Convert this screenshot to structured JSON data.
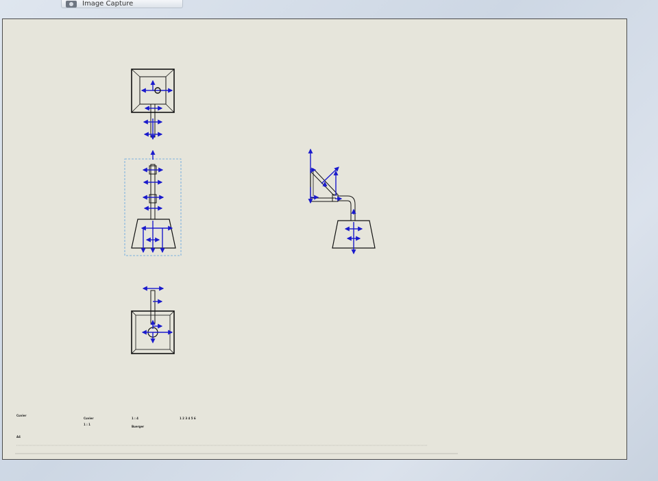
{
  "window": {
    "capture_label": "Image Capture",
    "capture_icon": "camera-icon"
  },
  "colors": {
    "sheet_background": "#e6e5db",
    "dimension_blue": "#1a1acc",
    "selection_dash": "#5aa0e0",
    "line_black": "#111111"
  },
  "title_block": {
    "val_1": "Cuvier",
    "val_2": "Cuvier",
    "val_3": "1 : 1",
    "val_4": "1 : 4",
    "val_5": "Buerger",
    "val_6": "1 2 3 4 5 6",
    "val_7": "A4"
  }
}
